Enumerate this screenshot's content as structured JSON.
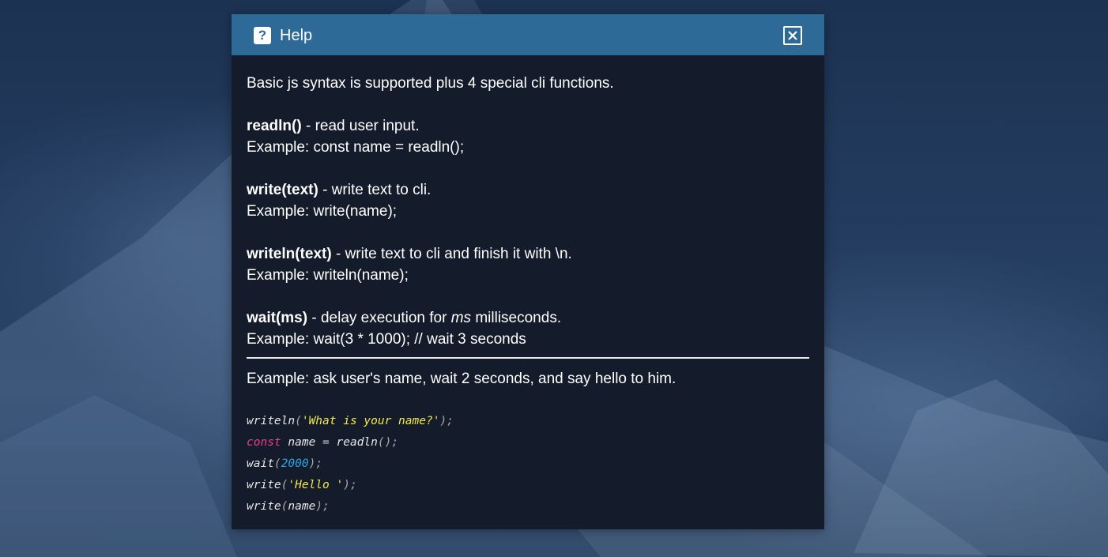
{
  "modal": {
    "title": "Help",
    "icon": "help-icon",
    "close_icon": "close-icon"
  },
  "intro": "Basic js syntax is supported plus 4 special cli functions.",
  "functions": [
    {
      "name": "readln()",
      "description": " - read user input.",
      "example": "Example: const name = readln();"
    },
    {
      "name": "write(text)",
      "description": " - write text to cli.",
      "example": "Example: write(name);"
    },
    {
      "name": "writeln(text)",
      "description": " - write text to cli and finish it with \\n.",
      "example": "Example: writeln(name);"
    },
    {
      "name": "wait(ms)",
      "description_before": " - delay execution for ",
      "description_em": "ms",
      "description_after": " milliseconds.",
      "example": "Example: wait(3 * 1000); // wait 3 seconds"
    }
  ],
  "example_intro": "Example: ask user's name, wait 2 seconds, and say hello to him.",
  "code": {
    "line1": {
      "fn": "writeln",
      "open": "(",
      "str": "'What is your name?'",
      "close": ");"
    },
    "line2": {
      "kw": "const",
      "var": " name ",
      "op": "=",
      "fn": " readln",
      "punc": "();"
    },
    "line3": {
      "fn": "wait",
      "open": "(",
      "num": "2000",
      "close": ");"
    },
    "line4": {
      "fn": "write",
      "open": "(",
      "str": "'Hello '",
      "close": ");"
    },
    "line5": {
      "fn": "write",
      "open": "(",
      "arg": "name",
      "close": ");"
    }
  },
  "colors": {
    "header": "#2d6a97",
    "panel": "#141c2b",
    "code_string": "#f3e84a",
    "code_keyword": "#e8418a",
    "code_number": "#2fa4e7"
  }
}
